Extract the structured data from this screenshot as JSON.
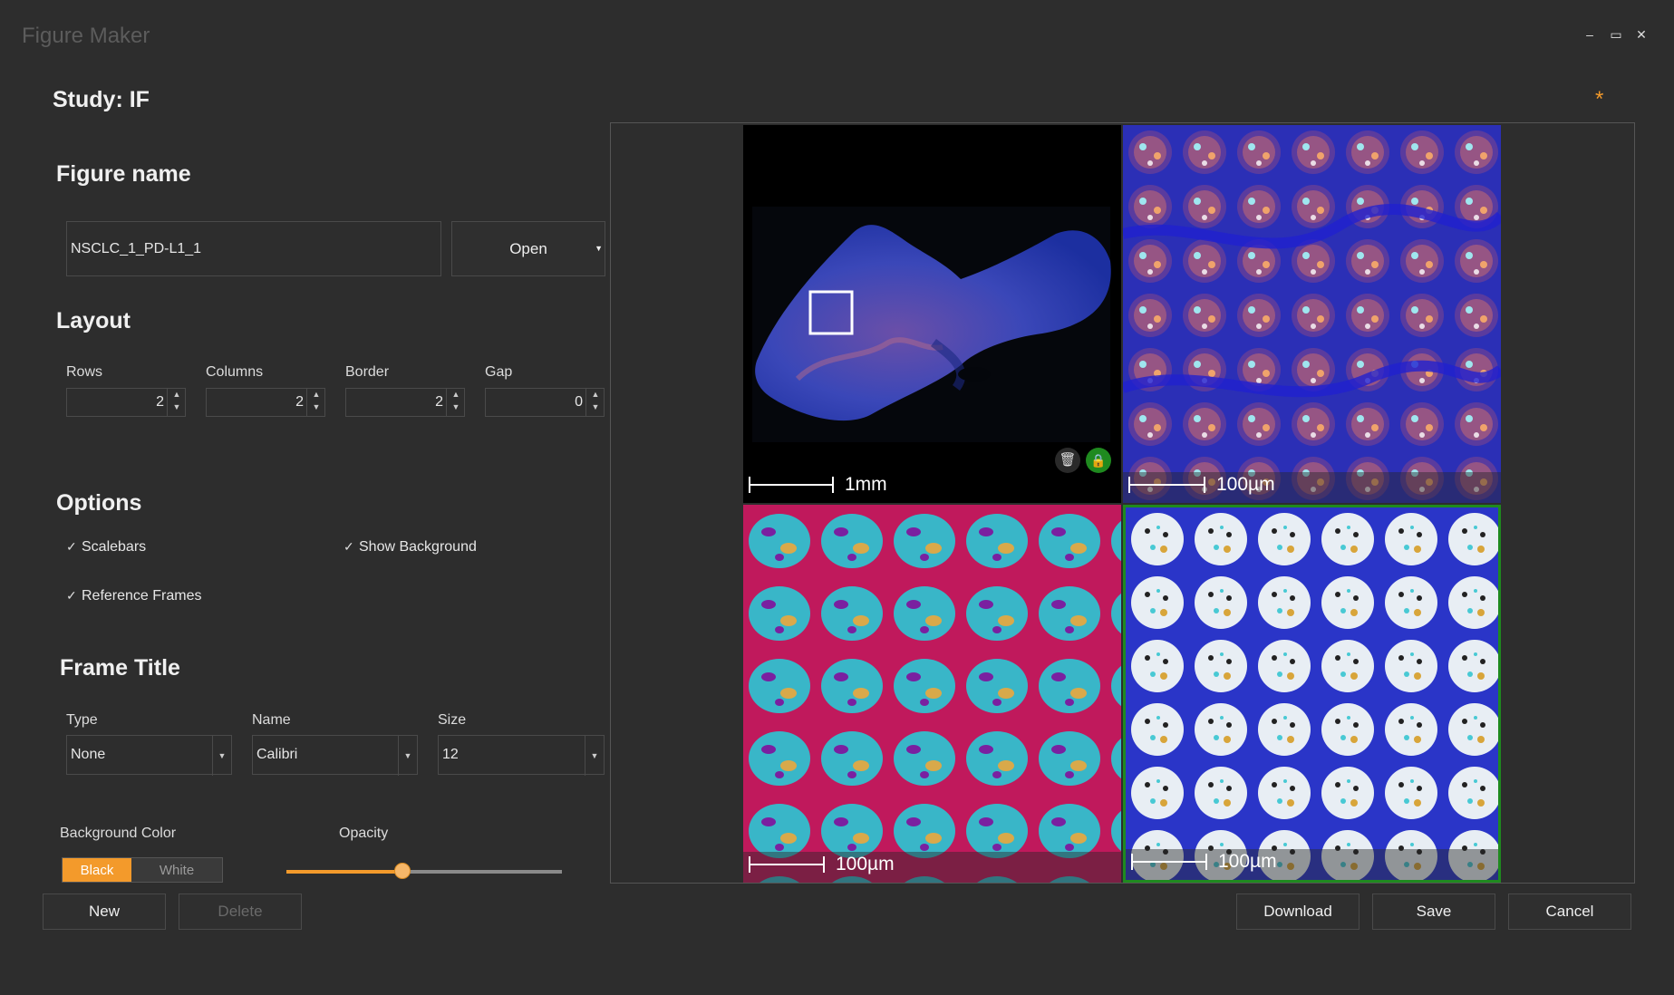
{
  "window": {
    "title": "Figure Maker",
    "minimize": "–",
    "maximize": "▭",
    "close": "✕",
    "modified_marker": "*"
  },
  "study": {
    "title": "Study: IF"
  },
  "figure_name": {
    "heading": "Figure name",
    "value": "NSCLC_1_PD-L1_1",
    "open_label": "Open"
  },
  "layout": {
    "heading": "Layout",
    "rows": {
      "label": "Rows",
      "value": "2"
    },
    "columns": {
      "label": "Columns",
      "value": "2"
    },
    "border": {
      "label": "Border",
      "value": "2"
    },
    "gap": {
      "label": "Gap",
      "value": "0"
    }
  },
  "options": {
    "heading": "Options",
    "scalebars": {
      "label": "Scalebars",
      "checked": true
    },
    "show_background": {
      "label": "Show Background",
      "checked": true
    },
    "reference_frames": {
      "label": "Reference Frames",
      "checked": true
    }
  },
  "frame_title": {
    "heading": "Frame Title",
    "type": {
      "label": "Type",
      "value": "None"
    },
    "name": {
      "label": "Name",
      "value": "Calibri"
    },
    "size": {
      "label": "Size",
      "value": "12"
    }
  },
  "background": {
    "label": "Background Color",
    "black": "Black",
    "white": "White",
    "selected": "Black"
  },
  "opacity": {
    "label": "Opacity",
    "value": 0.42
  },
  "buttons": {
    "new": "New",
    "delete": "Delete",
    "download": "Download",
    "save": "Save",
    "cancel": "Cancel"
  },
  "tiles": [
    {
      "scalebar": "1mm"
    },
    {
      "scalebar": "100µm"
    },
    {
      "scalebar": "100µm"
    },
    {
      "scalebar": "100µm"
    }
  ],
  "colors": {
    "accent": "#f39a2b",
    "selected_frame": "#1f8a1f",
    "lock": "#1f8a1f"
  }
}
